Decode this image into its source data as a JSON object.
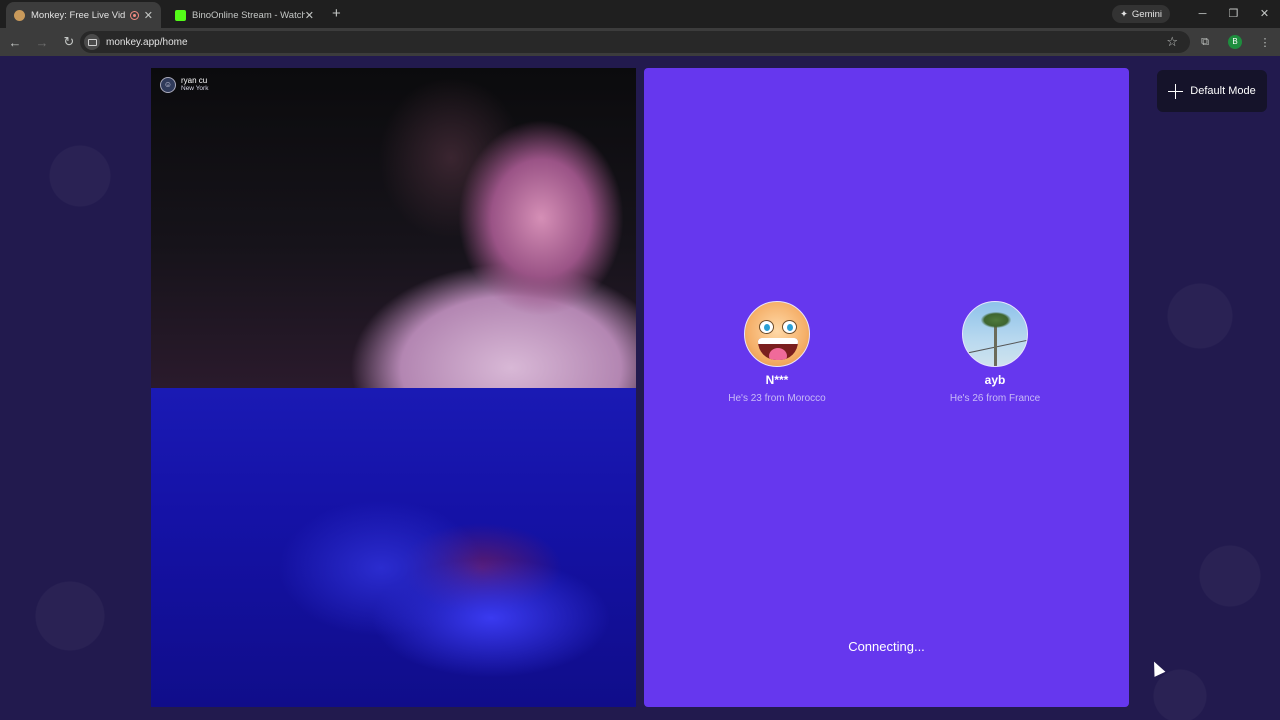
{
  "browser": {
    "tabs": [
      {
        "title": "Monkey: Free Live Video Ch",
        "active": true
      },
      {
        "title": "BinoOnline Stream - Watch Live",
        "active": false
      }
    ],
    "new_tab": "+",
    "gemini_label": "Gemini",
    "url": "monkey.app/home",
    "profile_initial": "B"
  },
  "video_top": {
    "user_name": "ryan cu",
    "user_location": "New York"
  },
  "match_panel": {
    "candidates": [
      {
        "name": "N***",
        "info": "He's 23 from Morocco",
        "avatar": "laughing-face-avatar"
      },
      {
        "name": "ayb",
        "info": "He's 26 from France",
        "avatar": "palm-tree-avatar"
      }
    ],
    "status": "Connecting..."
  },
  "mode_button": {
    "label": "Default Mode"
  },
  "colors": {
    "page_bg": "#221a4e",
    "panel_bg": "#6637ee",
    "mode_button_bg": "#15132a"
  }
}
